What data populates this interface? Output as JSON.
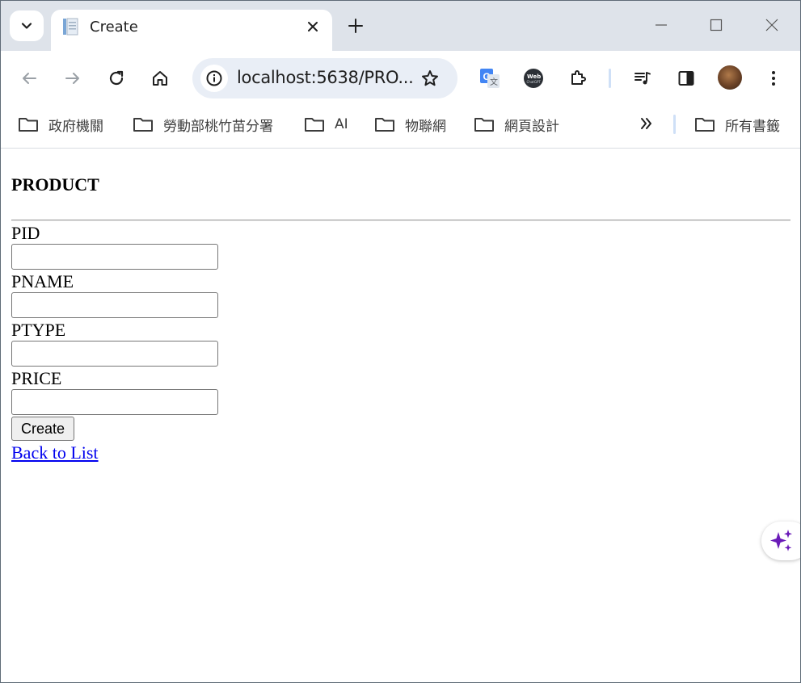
{
  "browser": {
    "tab_title": "Create",
    "url": "localhost:5638/PRO...",
    "icons": [
      "tab-search-chevron-icon",
      "tab-favicon-document-icon",
      "close-icon",
      "plus-icon",
      "minimize-icon",
      "maximize-icon",
      "window-close-icon",
      "back-arrow-icon",
      "forward-arrow-icon",
      "reload-icon",
      "home-icon",
      "site-info-icon",
      "bookmark-star-icon",
      "google-translate-icon",
      "webchatgpt-icon",
      "extensions-puzzle-icon",
      "media-queue-icon",
      "side-panel-icon",
      "profile-avatar",
      "more-menu-icon"
    ]
  },
  "bookmarks": {
    "items": [
      {
        "label": "政府機關"
      },
      {
        "label": "勞動部桃竹苗分署"
      },
      {
        "label": "AI"
      },
      {
        "label": "物聯網"
      },
      {
        "label": "網頁設計"
      }
    ],
    "all_bookmarks_label": "所有書籤"
  },
  "page": {
    "title": "PRODUCT",
    "fields": [
      {
        "label": "PID",
        "value": ""
      },
      {
        "label": "PNAME",
        "value": ""
      },
      {
        "label": "PTYPE",
        "value": ""
      },
      {
        "label": "PRICE",
        "value": ""
      }
    ],
    "submit_label": "Create",
    "back_link": "Back to List"
  },
  "colors": {
    "tabstrip": "#dee3ea",
    "omnibox": "#e9eef6",
    "link": "#0000ee",
    "sparkle": "#6a1bb8"
  }
}
